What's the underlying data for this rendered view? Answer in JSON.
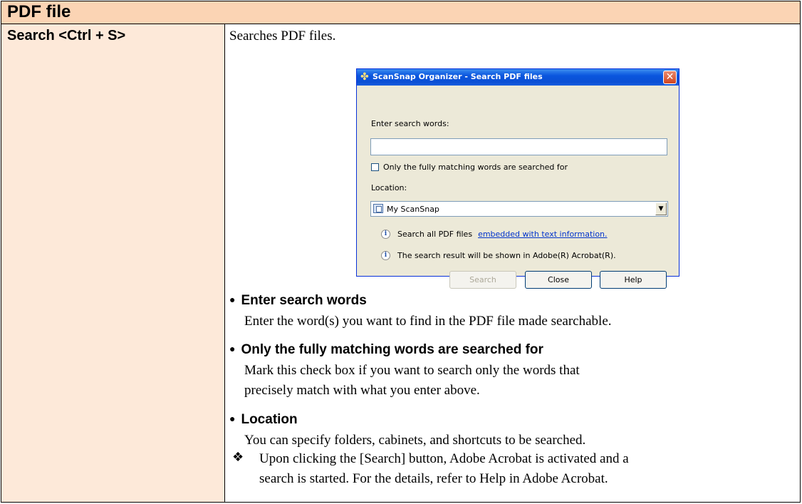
{
  "header": {
    "title": "PDF file"
  },
  "left": {
    "command": "Search <Ctrl + S>"
  },
  "intro": "Searches PDF files.",
  "dialog": {
    "title": "ScanSnap Organizer - Search PDF files",
    "close_glyph": "✕",
    "search_label": "Enter search words:",
    "search_value": "",
    "checkbox_label": "Only the fully matching words are searched for",
    "checkbox_checked": false,
    "location_label": "Location:",
    "location_value": "My ScanSnap",
    "info1_text": "Search all PDF files",
    "info1_link": "embedded with text information.",
    "info2_text": "The search result will be shown in Adobe(R) Acrobat(R).",
    "buttons": {
      "search": "Search",
      "close": "Close",
      "help": "Help"
    }
  },
  "bullets": [
    {
      "title": "Enter search words",
      "text": [
        "Enter the word(s) you want to find in the PDF file made searchable."
      ]
    },
    {
      "title": "Only the fully matching words are searched for",
      "text": [
        "Mark this check box if you want to search only the words that",
        "precisely match with what you enter above."
      ]
    },
    {
      "title": "Location",
      "text": [
        "You can specify folders, cabinets, and shortcuts to be searched."
      ]
    }
  ],
  "note": {
    "mark": "❖",
    "lines": [
      "Upon clicking the [Search] button, Adobe Acrobat is activated and a",
      "search is started. For the details, refer to Help in Adobe Acrobat."
    ]
  }
}
